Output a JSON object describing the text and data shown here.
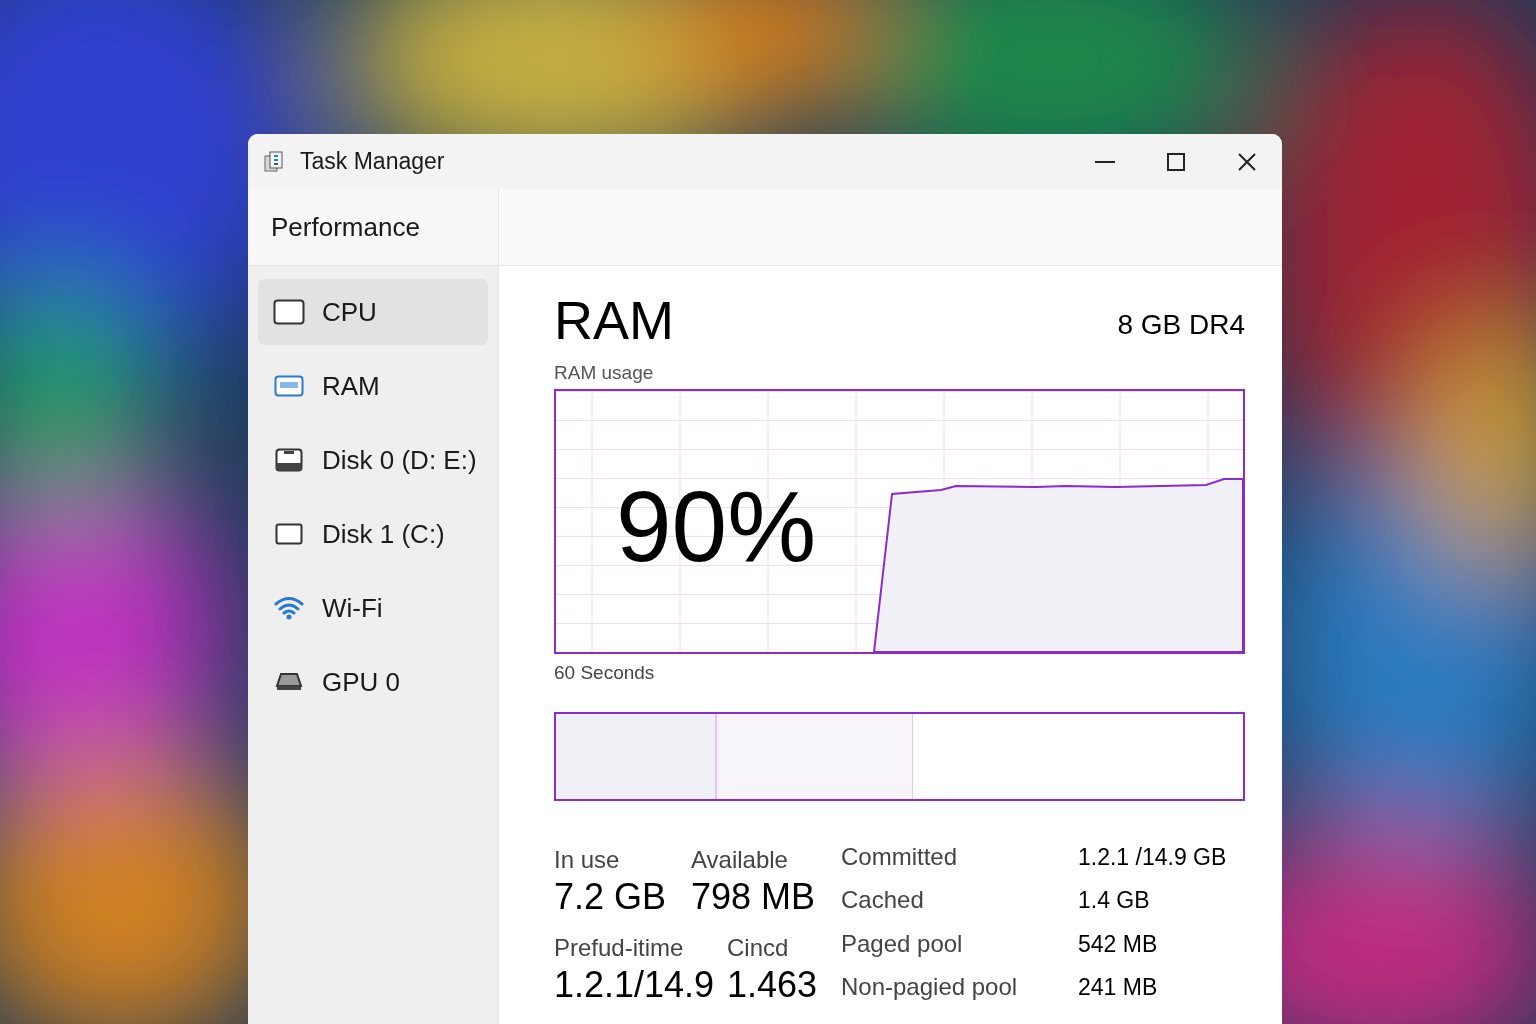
{
  "window": {
    "title": "Task Manager"
  },
  "sidebar": {
    "heading": "Performance",
    "items": [
      {
        "label": "CPU",
        "kind": "cpu",
        "selected": true
      },
      {
        "label": "RAM",
        "kind": "memory",
        "selected": false
      },
      {
        "label": "Disk 0 (D: E:)",
        "kind": "disk",
        "selected": false
      },
      {
        "label": "Disk 1 (C:)",
        "kind": "drive",
        "selected": false
      },
      {
        "label": "Wi-Fi",
        "kind": "wifi",
        "selected": false
      },
      {
        "label": "GPU 0",
        "kind": "gpu",
        "selected": false
      }
    ]
  },
  "main": {
    "title": "RAM",
    "spec": "8 GB DR4",
    "graph_label": "RAM usage",
    "percent": "90%",
    "time_label": "60 Seconds",
    "composition": [
      {
        "level": 0.235
      },
      {
        "level": 0.285
      }
    ],
    "stats": [
      [
        {
          "label": "In use",
          "value": "7.2 GB"
        },
        {
          "label": "Available",
          "value": "798 MB"
        }
      ],
      [
        {
          "label": "Prefud-itime",
          "value": "1.2.1/14.9"
        },
        {
          "label": "Cincd",
          "value": "1.463"
        }
      ]
    ],
    "details": [
      {
        "label": "Committed",
        "value": "1.2.1 /14.9 GB"
      },
      {
        "label": "Cached",
        "value": "1.4 GB"
      },
      {
        "label": "Paged pool",
        "value": "542 MB"
      },
      {
        "label": "Non-pagied pool",
        "value": "241 MB"
      }
    ]
  }
}
